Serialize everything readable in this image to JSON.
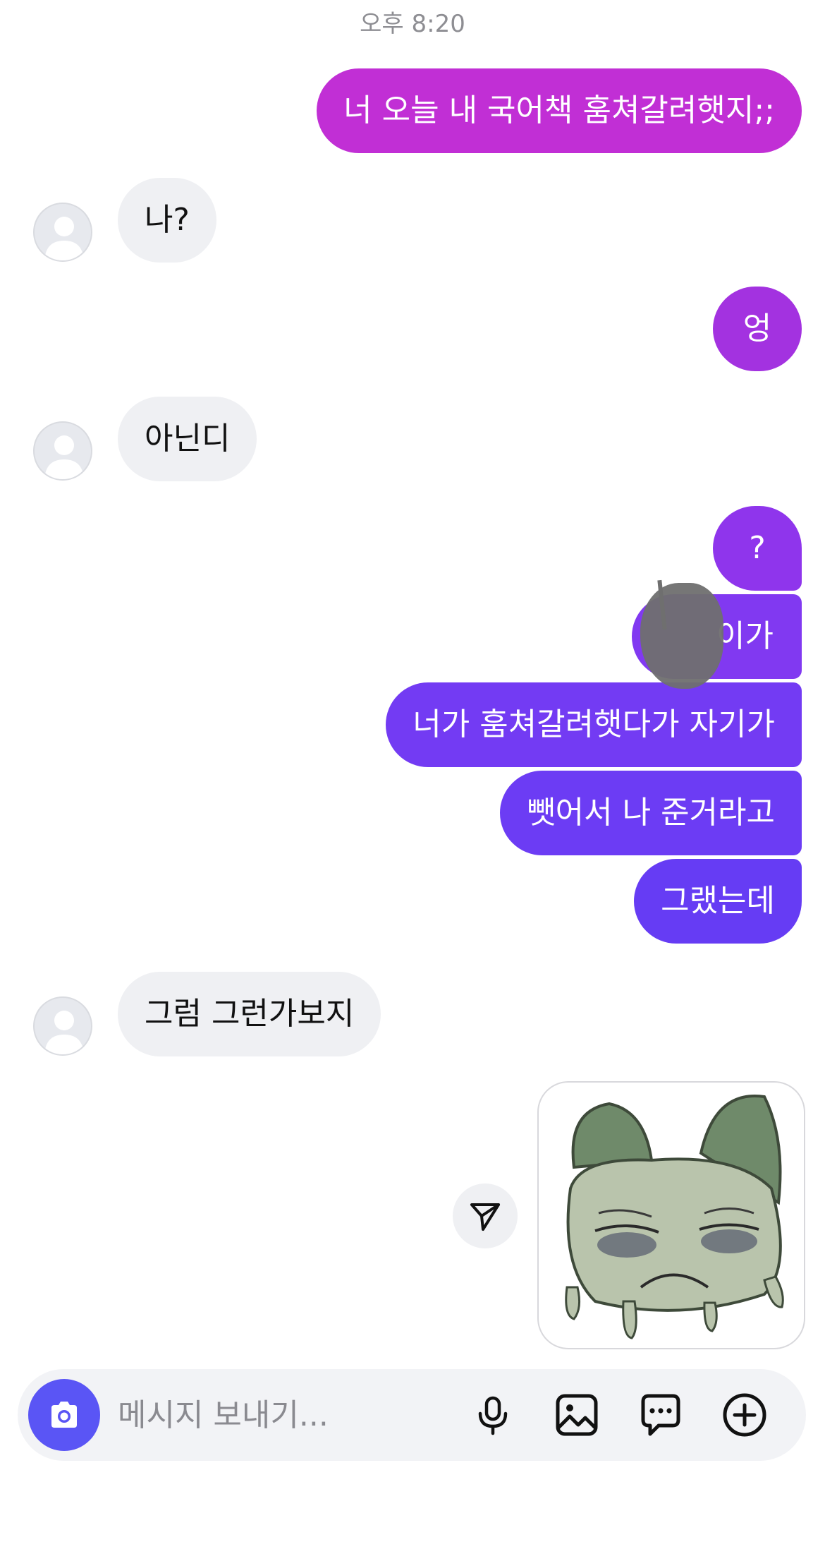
{
  "timestamp": "오후 8:20",
  "messages": [
    {
      "text": "너 오늘 내 국어책 훔쳐갈려햇지;;"
    },
    {
      "text": "나?"
    },
    {
      "text": "엉"
    },
    {
      "text": "아닌디"
    },
    {
      "text": "?"
    },
    {
      "text": "이가"
    },
    {
      "text": "너가 훔쳐갈려햇다가 자기가"
    },
    {
      "text": "뺏어서 나 준거라고"
    },
    {
      "text": "그랬는데"
    },
    {
      "text": "그럼 그런가보지"
    }
  ],
  "composer": {
    "placeholder": "메시지 보내기..."
  },
  "icons": {
    "camera": "camera-icon",
    "mic": "microphone-icon",
    "gallery": "image-icon",
    "sticker": "chat-bubble-dots-icon",
    "add": "plus-circle-icon",
    "share": "paper-plane-icon",
    "avatar": "default-user-icon"
  },
  "colors": {
    "outgoing_top": "#c130d6",
    "outgoing_mid": "#8a35ef",
    "outgoing_bottom": "#6a3bf4",
    "incoming": "#eff0f3",
    "camera_button": "#5a55f5",
    "timestamp": "#8e8e93"
  }
}
